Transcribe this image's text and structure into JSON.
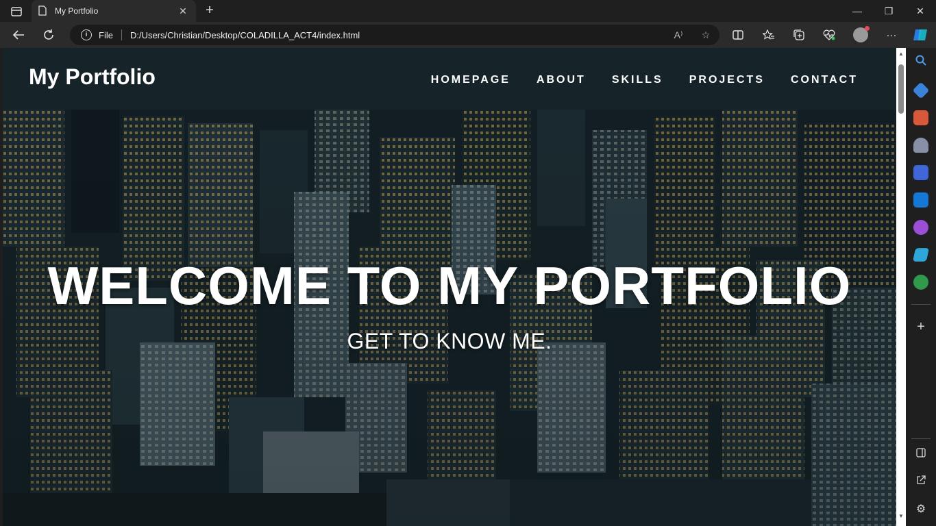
{
  "browser": {
    "tab_title": "My Portfolio",
    "scheme_label": "File",
    "url": "D:/Users/Christian/Desktop/COLADILLA_ACT4/index.html",
    "new_tab_symbol": "+",
    "close_tab_symbol": "✕",
    "window": {
      "minimize": "—",
      "restore": "❐",
      "close": "✕"
    }
  },
  "site": {
    "logo": "My Portfolio",
    "nav": [
      "HOMEPAGE",
      "ABOUT",
      "SKILLS",
      "PROJECTS",
      "CONTACT"
    ],
    "hero_title": "WELCOME TO MY PORTFOLIO",
    "hero_subtitle": "GET TO KNOW ME."
  },
  "colors": {
    "header_bg": "#162329",
    "accent_text": "#ffffff",
    "chrome_bg": "#2b2b2b"
  },
  "sidebar_icons": [
    "search-icon",
    "tag-icon",
    "briefcase-icon",
    "chess-icon",
    "copilot-icon",
    "outlook-icon",
    "designer-icon",
    "send-icon",
    "tree-icon",
    "add-icon",
    "split-icon",
    "external-icon",
    "settings-icon"
  ]
}
